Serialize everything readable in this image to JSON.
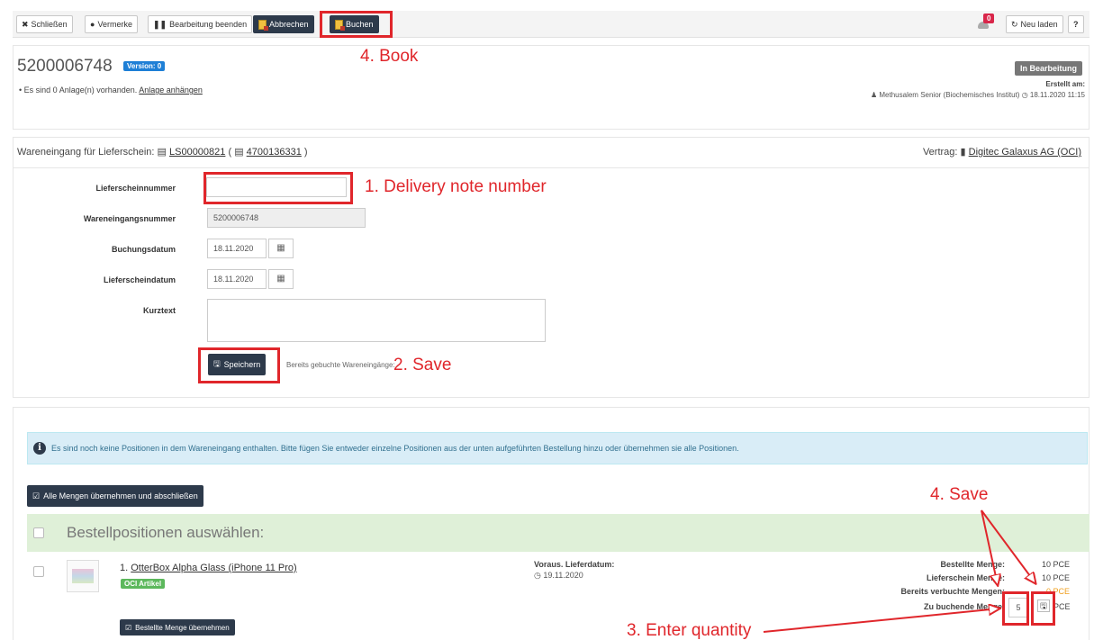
{
  "toolbar": {
    "close_label": "Schließen",
    "notes_label": "Vermerke",
    "finish_label": "Bearbeitung beenden",
    "cancel_label": "Abbrechen",
    "book_label": "Buchen",
    "notification_count": "0",
    "reload_label": "Neu laden",
    "help_label": "?"
  },
  "header": {
    "doc_number": "5200006748",
    "version_badge": "Version: 0",
    "attachments_text": "Es sind 0 Anlage(n) vorhanden.",
    "attach_link": "Anlage anhängen",
    "status_badge": "In Bearbeitung",
    "created_label": "Erstellt am:",
    "creator": "Methusalem Senior (Biochemisches Institut)",
    "created_date": "18.11.2020 11:15"
  },
  "receipt": {
    "title_prefix": "Wareneingang für Lieferschein:",
    "ls_number": "LS00000821",
    "order_number": "4700136331",
    "contract_label": "Vertrag:",
    "contract_name": "Digitec Galaxus AG (OCI)"
  },
  "form": {
    "delivery_note_label": "Lieferscheinnummer",
    "delivery_note_value": "",
    "goods_receipt_label": "Wareneingangsnummer",
    "goods_receipt_value": "5200006748",
    "booking_date_label": "Buchungsdatum",
    "booking_date_value": "18.11.2020",
    "delivery_date_label": "Lieferscheindatum",
    "delivery_date_value": "18.11.2020",
    "short_text_label": "Kurztext",
    "short_text_value": "",
    "save_label": "Speichern",
    "already_booked_label": "Bereits gebuchte Wareneingänge:"
  },
  "positions": {
    "info_text": "Es sind noch keine Positionen in dem Wareneingang enthalten. Bitte fügen Sie entweder einzelne Positionen aus der unten aufgeführten Bestellung hinzu oder übernehmen sie alle Positionen.",
    "accept_all_label": "Alle Mengen übernehmen und abschließen",
    "select_header": "Bestellpositionen auswählen:",
    "items": [
      {
        "title_num": "1.",
        "title": "OtterBox Alpha Glass (iPhone 11 Pro)",
        "tag": "OCI Artikel",
        "accept_label": "Bestellte Menge übernehmen",
        "expected_label": "Voraus. Lieferdatum:",
        "expected_date": "19.11.2020",
        "ordered_label": "Bestellte Menge:",
        "ordered_value": "10 PCE",
        "delivery_note_qty_label": "Lieferschein Menge:",
        "delivery_note_qty_value": "10 PCE",
        "already_booked_label": "Bereits verbuchte Mengen:",
        "already_booked_value": "0 PCE",
        "to_book_label": "Zu buchende Menge:",
        "to_book_value": "5",
        "unit": "PCE"
      }
    ]
  },
  "annotations": {
    "book": "4. Book",
    "delivery_note": "1. Delivery note number",
    "save": "2. Save",
    "save_item": "4. Save",
    "enter_qty": "3. Enter quantity"
  },
  "colors": {
    "annotation_red": "#e0262b",
    "dark_button": "#2d3a4b",
    "info_blue": "#d9edf7",
    "success_green": "#dff0d8",
    "badge_blue": "#1e7fd6",
    "badge_green": "#5cb85c",
    "status_grey": "#777777",
    "warning_orange": "#f0a020"
  }
}
